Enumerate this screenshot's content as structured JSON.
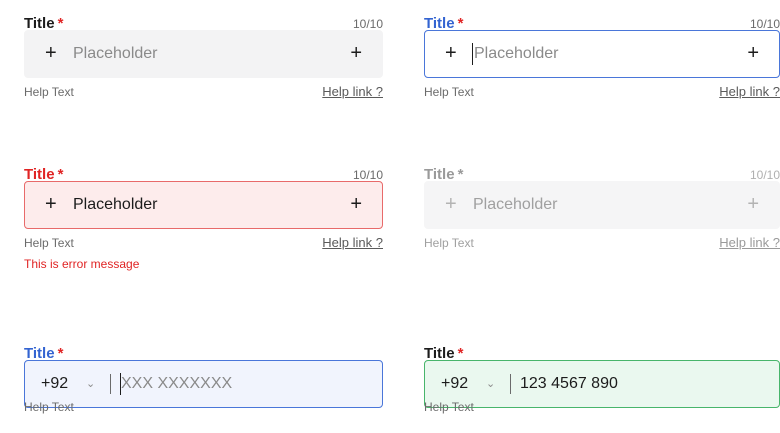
{
  "fields": {
    "default": {
      "title": "Title",
      "required_mark": "*",
      "counter": "10/10",
      "placeholder": "Placeholder",
      "help_text": "Help Text",
      "help_link": "Help link ?",
      "left_icon": "plus-icon",
      "right_icon": "plus-icon"
    },
    "focused": {
      "title": "Title",
      "required_mark": "*",
      "counter": "10/10",
      "placeholder": "Placeholder",
      "help_text": "Help Text",
      "help_link": "Help link ?",
      "left_icon": "plus-icon",
      "right_icon": "plus-icon"
    },
    "error": {
      "title": "Title",
      "required_mark": "*",
      "counter": "10/10",
      "value": "Placeholder",
      "help_text": "Help Text",
      "help_link": "Help link ?",
      "error_message": "This is error message",
      "left_icon": "plus-icon",
      "right_icon": "plus-icon"
    },
    "disabled": {
      "title": "Title",
      "required_mark": "*",
      "counter": "10/10",
      "placeholder": "Placeholder",
      "help_text": "Help Text",
      "help_link": "Help link ?",
      "left_icon": "plus-icon",
      "right_icon": "plus-icon"
    },
    "phone_focused": {
      "title": "Title",
      "required_mark": "*",
      "country_code": "+92",
      "placeholder": "XXX XXXXXXX",
      "help_text": "Help Text",
      "chevron_icon": "chevron-down-icon"
    },
    "phone_valid": {
      "title": "Title",
      "required_mark": "*",
      "country_code": "+92",
      "value": "123 4567 890",
      "help_text": "Help Text",
      "chevron_icon": "chevron-down-icon"
    }
  },
  "colors": {
    "focus_blue": "#4a76d9",
    "error_red": "#e02424",
    "valid_green": "#48b56b",
    "required_star": "#e02424"
  }
}
